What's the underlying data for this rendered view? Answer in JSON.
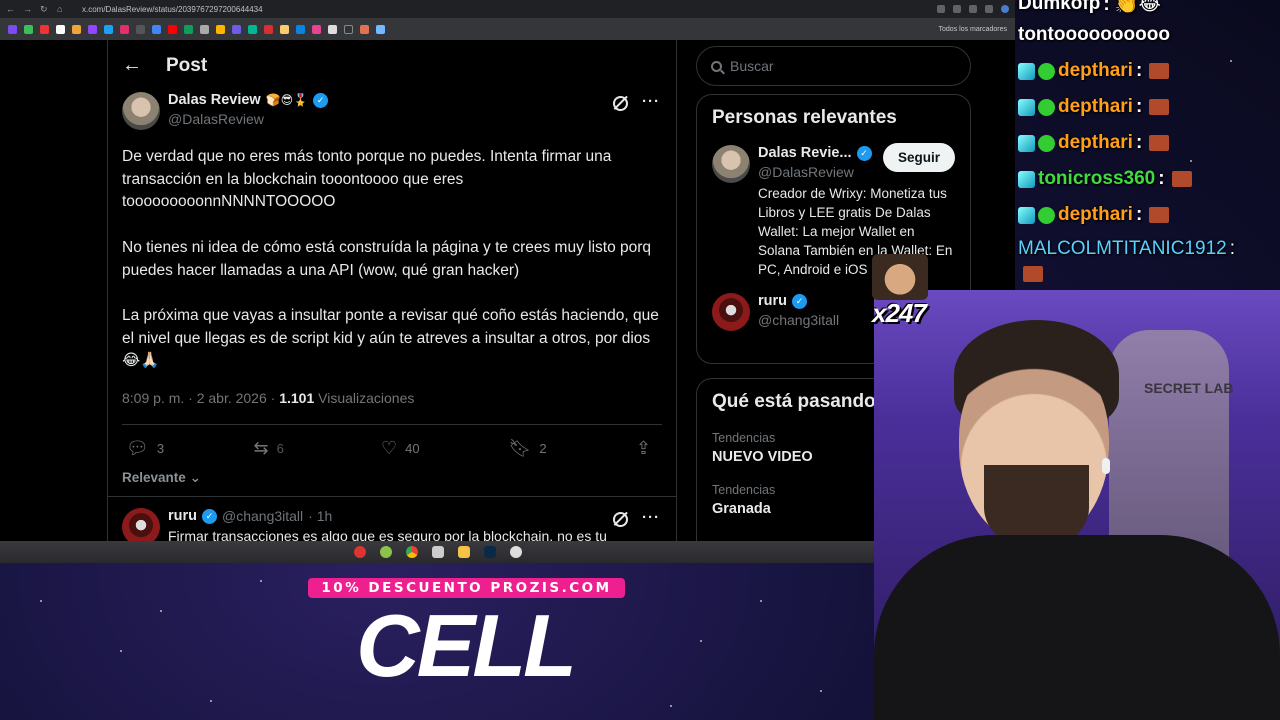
{
  "browser": {
    "url": "x.com/DalasReview/status/2039767297200644434",
    "bookmarks_label": "Todos los marcadores"
  },
  "post": {
    "header_title": "Post",
    "author_name": "Dalas Review",
    "author_emojis": "🍞😎🎖️",
    "author_handle": "@DalasReview",
    "body": "De verdad que no eres más tonto porque no puedes. Intenta firmar una transacción en la blockchain tooontoooo que eres tooooooooonnNNNNTOOOOO\n\nNo tienes ni idea de cómo está construída la página y te crees muy listo porq puedes hacer llamadas a una API (wow, qué gran hacker)\n\nLa próxima que vayas a insultar ponte a revisar qué coño estás haciendo, que el nivel que llegas es de script kid y aún te atreves a insultar a otros, por dios 😂🙏🏻",
    "time_date": "8:09 p. m. · 2 abr. 2026 · ",
    "views_count": "1.101",
    "views_label": " Visualizaciones",
    "replies": "3",
    "reposts": "6",
    "likes": "40",
    "bookmarks": "2",
    "sort_label": "Relevante"
  },
  "reply": {
    "name": "ruru",
    "handle": "@chang3itall",
    "time": "· 1h",
    "text": "Firmar transacciones es algo que es seguro por la blockchain, no es tu"
  },
  "sidebar": {
    "search_placeholder": "Buscar",
    "relevant_title": "Personas relevantes",
    "person1_name": "Dalas Revie...",
    "person1_handle": "@DalasReview",
    "follow_label": "Seguir",
    "person1_bio": "Creador de Wrixy: Monetiza tus Libros y LEE gratis De Dalas Wallet: La mejor Wallet en Solana También en la Wallet: En PC, Android e iOS",
    "person2_name": "ruru",
    "person2_handle": "@chang3itall",
    "trending_title": "Qué está pasando",
    "trends": [
      {
        "category": "Tendencias",
        "name": "NUEVO VIDEO"
      },
      {
        "category": "Tendencias",
        "name": "Granada"
      }
    ]
  },
  "chat": {
    "messages": [
      {
        "user": "Dumkofp",
        "text": ": 👏😂"
      },
      {
        "user": "",
        "text": "tontoooooooooo"
      },
      {
        "user": "depthari",
        "text": ":"
      },
      {
        "user": "depthari",
        "text": ":"
      },
      {
        "user": "depthari",
        "text": ":"
      },
      {
        "user": "tonicross360",
        "text": ":"
      },
      {
        "user": "depthari",
        "text": ":"
      },
      {
        "user": "MALCOLMTITANIC1912",
        "text": ":"
      }
    ]
  },
  "overlay": {
    "emote_count": "x247",
    "promo_text": "10% DESCUENTO PROZIS.COM",
    "promo_code": "CELL",
    "chair_brand": "SECRET LAB"
  },
  "colors": {
    "x_blue": "#1d9bf0",
    "promo_pink": "#ee1f8e",
    "chat_green": "#3fdc3f"
  }
}
